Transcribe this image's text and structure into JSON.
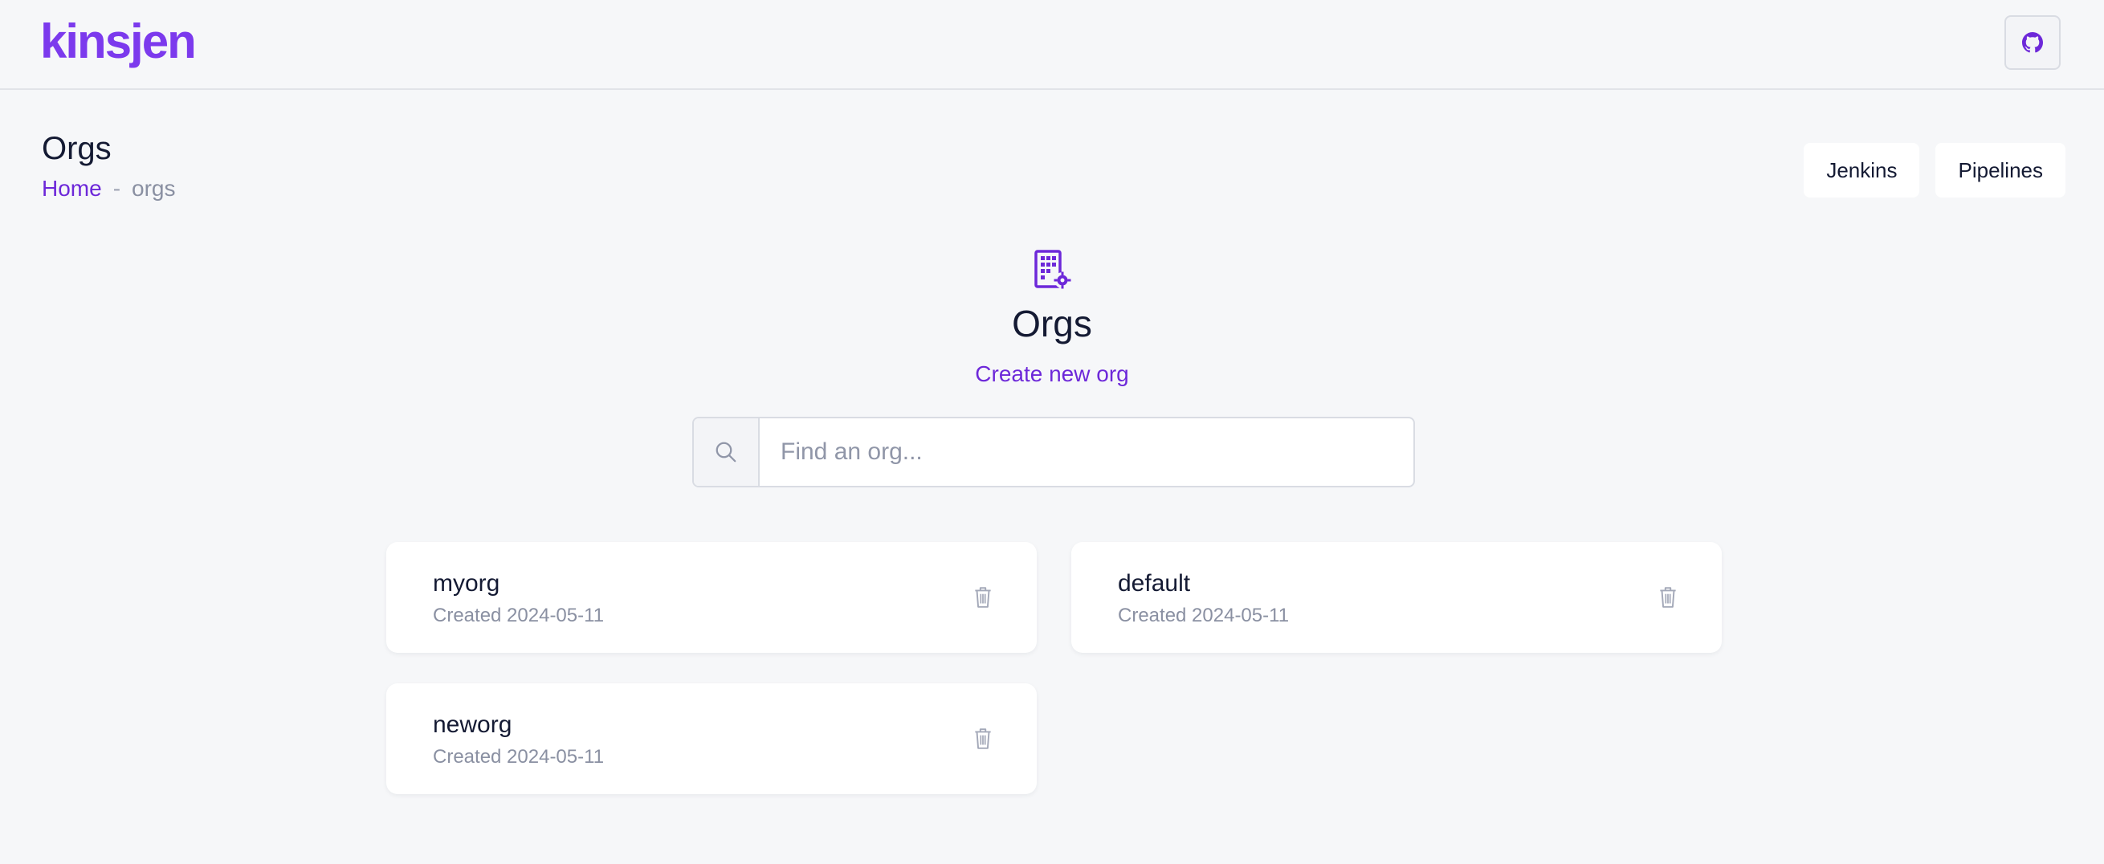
{
  "header": {
    "logo_text": "kinsjen",
    "github_icon": "github-icon"
  },
  "page": {
    "title": "Orgs",
    "breadcrumb": {
      "home": "Home",
      "separator": "-",
      "current": "orgs"
    }
  },
  "actions": {
    "jenkins": "Jenkins",
    "pipelines": "Pipelines"
  },
  "main": {
    "icon": "building-gear-icon",
    "title": "Orgs",
    "create_link": "Create new org",
    "search": {
      "placeholder": "Find an org...",
      "value": ""
    },
    "orgs": [
      {
        "name": "myorg",
        "created": "Created 2024-05-11"
      },
      {
        "name": "default",
        "created": "Created 2024-05-11"
      },
      {
        "name": "neworg",
        "created": "Created 2024-05-11"
      }
    ]
  },
  "colors": {
    "accent": "#7c3aed",
    "link": "#6d28d9",
    "background": "#f6f7f9",
    "text": "#141a33",
    "muted": "#8a90a2"
  }
}
